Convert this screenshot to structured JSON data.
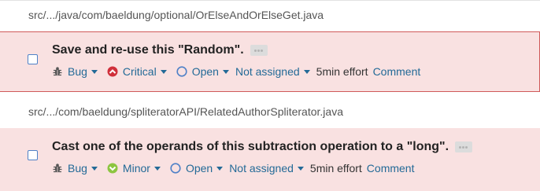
{
  "files": [
    {
      "path": "src/.../java/com/baeldung/optional/OrElseAndOrElseGet.java",
      "issue": {
        "title": "Save and re-use this \"Random\".",
        "type": "Bug",
        "severity": "Critical",
        "status": "Open",
        "assignee": "Not assigned",
        "effort": "5min effort",
        "comment": "Comment"
      }
    },
    {
      "path": "src/.../com/baeldung/spliteratorAPI/RelatedAuthorSpliterator.java",
      "issue": {
        "title": "Cast one of the operands of this subtraction operation to a \"long\".",
        "type": "Bug",
        "severity": "Minor",
        "status": "Open",
        "assignee": "Not assigned",
        "effort": "5min effort",
        "comment": "Comment"
      }
    }
  ],
  "icons": {
    "bug": "bug-icon",
    "critical": "critical-severity-icon",
    "minor": "minor-severity-icon",
    "open": "open-status-icon",
    "more": "more-options-icon"
  },
  "colors": {
    "issue_bg": "#f9e1e1",
    "selected_border": "#d05a5a",
    "link": "#236a97",
    "critical": "#d02f3a",
    "minor": "#8dc540"
  }
}
